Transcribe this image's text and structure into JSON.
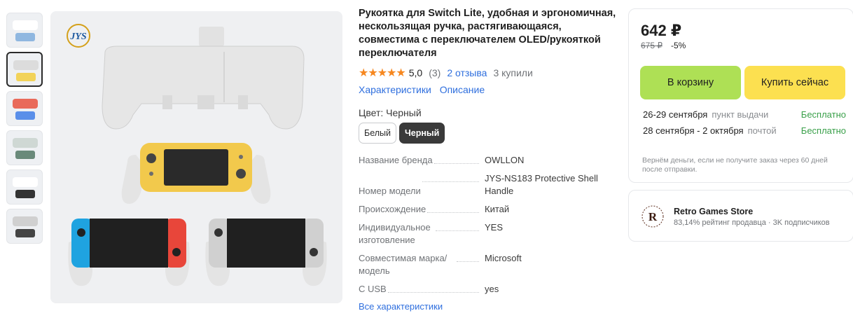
{
  "product": {
    "title": "Рукоятка для Switch Lite, удобная и эргономичная, нескользящая ручка, растягивающаяся, совместима с переключателем OLED/рукояткой переключателя",
    "rating_stars": "★★★★★",
    "rating_value": "5,0",
    "rating_count": "(3)",
    "reviews_link": "2 отзыва",
    "bought": "3 купили",
    "logo_text": "JYS"
  },
  "tabs": [
    {
      "label": "Характеристики"
    },
    {
      "label": "Описание"
    }
  ],
  "color": {
    "label": "Цвет: Черный",
    "options": [
      {
        "label": "Белый",
        "selected": false
      },
      {
        "label": "Черный",
        "selected": true
      }
    ]
  },
  "specs": [
    {
      "key": "Название бренда",
      "value": "OWLLON"
    },
    {
      "key": "Номер модели",
      "value": "JYS-NS183 Protective Shell Handle"
    },
    {
      "key": "Происхождение",
      "value": "Китай"
    },
    {
      "key": "Индивидуальное изготовление",
      "value": "YES"
    },
    {
      "key": "Совместимая марка/модель",
      "value": "Microsoft"
    },
    {
      "key": "С USB",
      "value": "yes"
    }
  ],
  "all_specs_link": "Все характеристики",
  "purchase": {
    "price": "642 ₽",
    "old_price": "675 ₽",
    "discount": "-5%",
    "cart_button": "В корзину",
    "buy_button": "Купить сейчас",
    "delivery": [
      {
        "date": "26-29 сентября",
        "method": "пункт выдачи",
        "cost": "Бесплатно"
      },
      {
        "date": "28 сентября - 2 октября",
        "method": "почтой",
        "cost": "Бесплатно"
      }
    ],
    "refund_note": "Вернём деньги, если не получите заказ через 60 дней после отправки."
  },
  "seller": {
    "name": "Retro Games Store",
    "rating": "83,14% рейтинг продавца",
    "subscribers": "3K подписчиков",
    "separator": "·",
    "logo_letter": "R"
  },
  "colors": {
    "link": "#2f6fde",
    "star": "#f6871f",
    "cart_button": "#aee055",
    "buy_button": "#fce050",
    "free_delivery": "#3aa04a"
  }
}
